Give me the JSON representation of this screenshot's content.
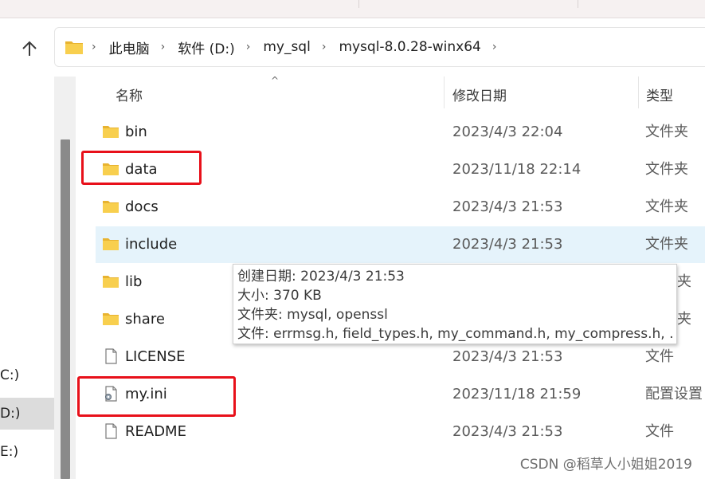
{
  "address_bar": {
    "crumbs": [
      "此电脑",
      "软件 (D:)",
      "my_sql",
      "mysql-8.0.28-winx64"
    ],
    "separator": "›"
  },
  "nav_pane": {
    "drives": [
      {
        "label": "C:)",
        "selected": false
      },
      {
        "label": "D:)",
        "selected": true
      },
      {
        "label": "E:)",
        "selected": false
      }
    ]
  },
  "columns": {
    "name": "名称",
    "date": "修改日期",
    "type": "类型"
  },
  "files": [
    {
      "name": "bin",
      "date": "2023/4/3 22:04",
      "type": "文件夹",
      "icon": "folder-icon"
    },
    {
      "name": "data",
      "date": "2023/11/18 22:14",
      "type": "文件夹",
      "icon": "folder-icon"
    },
    {
      "name": "docs",
      "date": "2023/4/3 21:53",
      "type": "文件夹",
      "icon": "folder-icon"
    },
    {
      "name": "include",
      "date": "2023/4/3 21:53",
      "type": "文件夹",
      "icon": "folder-icon"
    },
    {
      "name": "lib",
      "date": "",
      "type": "夹",
      "icon": "folder-icon"
    },
    {
      "name": "share",
      "date": "",
      "type": "夹",
      "icon": "folder-icon"
    },
    {
      "name": "LICENSE",
      "date": "2023/4/3 21:53",
      "type": "文件",
      "icon": "file-icon"
    },
    {
      "name": "my.ini",
      "date": "2023/11/18 21:59",
      "type": "配置设置",
      "icon": "config-file-icon"
    },
    {
      "name": "README",
      "date": "2023/4/3 21:53",
      "type": "文件",
      "icon": "file-icon"
    }
  ],
  "tooltip": {
    "created": "创建日期: 2023/4/3 21:53",
    "size": "大小: 370 KB",
    "folders": "文件夹: mysql, openssl",
    "files": "文件: errmsg.h, field_types.h, my_command.h, my_compress.h, ..."
  },
  "watermark": "CSDN @稻草人小姐姐2019",
  "colors": {
    "highlight_box": "#e8101a",
    "hover_row": "#e5f3fb",
    "folder": "#f5c542"
  }
}
